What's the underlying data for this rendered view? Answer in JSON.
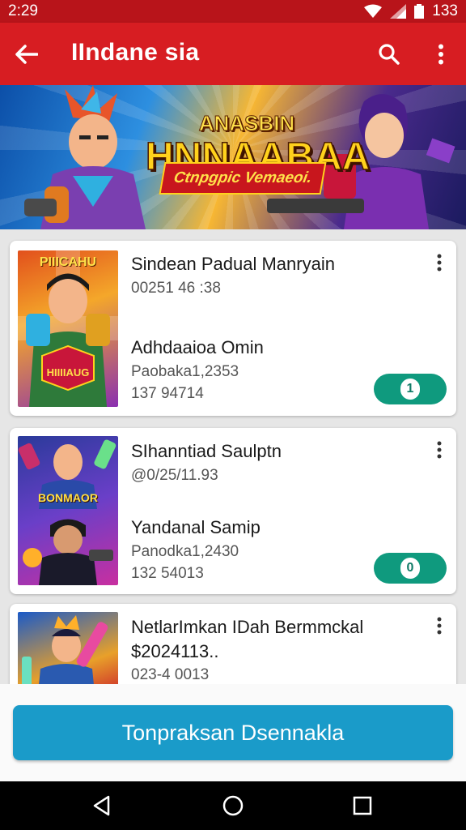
{
  "status_bar": {
    "time": "2:29",
    "battery_text": "133"
  },
  "app_bar": {
    "title": "IIndane sia"
  },
  "banner": {
    "title_small": "ANASBIN",
    "title_big": "HNNAABAA",
    "ribbon": "Ctnpgpic Vemaeoi."
  },
  "items": [
    {
      "title": "Sindean Padual Manryain",
      "code": "00251 46 :38",
      "subtitle": "Adhdaaioa Omin",
      "detail1": "Paobaka1,2353",
      "detail2": "137 94714",
      "thumb_text_top": "PIIICAHU",
      "thumb_text_bottom": "HIIIIAUG",
      "toggle_label": "1"
    },
    {
      "title": "SIhanntiad Saulptn",
      "code": "@0/25/11.93",
      "subtitle": "Yandanal Samip",
      "detail1": "Panodka1,2430",
      "detail2": "132 54013",
      "thumb_text_top": "BONMAOR",
      "toggle_label": "0"
    },
    {
      "title": "NetlarImkan IDah Bermmckal",
      "code": "$2024113..",
      "detail2": "023-4 0013"
    }
  ],
  "cta": {
    "label": "Tonpraksan Dsennakla"
  },
  "colors": {
    "app_bar": "#d71d22",
    "status_bar": "#b8141a",
    "toggle": "#0f9a7e",
    "cta": "#1a9bc9"
  }
}
